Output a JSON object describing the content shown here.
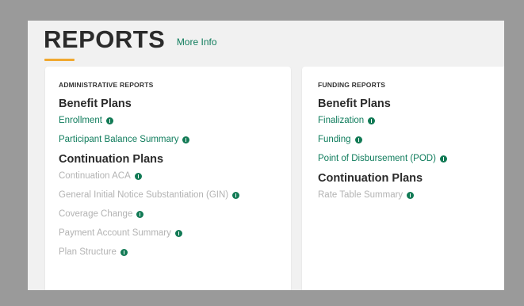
{
  "header": {
    "title": "REPORTS",
    "more_info": "More Info"
  },
  "admin": {
    "label": "ADMINISTRATIVE REPORTS",
    "groups": [
      {
        "title": "Benefit Plans",
        "items": [
          {
            "label": "Enrollment",
            "enabled": true
          },
          {
            "label": "Participant Balance Summary",
            "enabled": true
          }
        ]
      },
      {
        "title": "Continuation Plans",
        "items": [
          {
            "label": "Continuation ACA",
            "enabled": false
          },
          {
            "label": "General Initial Notice Substantiation (GIN)",
            "enabled": false
          },
          {
            "label": "Coverage Change",
            "enabled": false
          },
          {
            "label": "Payment Account Summary",
            "enabled": false
          },
          {
            "label": "Plan Structure",
            "enabled": false
          }
        ]
      }
    ]
  },
  "funding": {
    "label": "FUNDING REPORTS",
    "groups": [
      {
        "title": "Benefit Plans",
        "items": [
          {
            "label": "Finalization",
            "enabled": true
          },
          {
            "label": "Funding",
            "enabled": true
          },
          {
            "label": "Point of Disbursement (POD)",
            "enabled": true
          }
        ]
      },
      {
        "title": "Continuation Plans",
        "items": [
          {
            "label": "Rate Table Summary",
            "enabled": false
          }
        ]
      }
    ]
  }
}
